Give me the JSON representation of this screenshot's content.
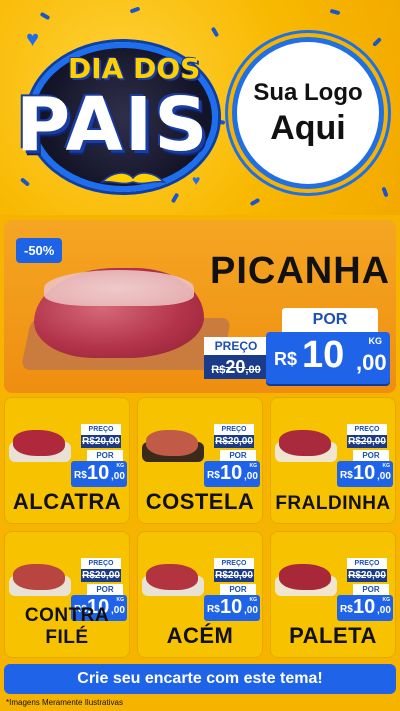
{
  "header": {
    "title_top": "DIA DOS",
    "title_main": "PAIS",
    "logo_line1": "Sua Logo",
    "logo_line2": "Aqui"
  },
  "featured": {
    "discount": "-50%",
    "name": "PICANHA",
    "preco_label": "PREÇO",
    "old_currency": "R$",
    "old_int": "20",
    "old_dec": ",00",
    "por_label": "POR",
    "new_currency": "R$",
    "new_int": "10",
    "new_dec": ",00",
    "unit": "KG"
  },
  "products": [
    {
      "name": "ALCATRA",
      "preco_label": "PREÇO",
      "old": "R$20,00",
      "por_label": "POR",
      "cur": "R$",
      "int": "10",
      "dec": ",00",
      "unit": "KG"
    },
    {
      "name": "COSTELA",
      "preco_label": "PREÇO",
      "old": "R$20,00",
      "por_label": "POR",
      "cur": "R$",
      "int": "10",
      "dec": ",00",
      "unit": "KG"
    },
    {
      "name": "FRALDINHA",
      "preco_label": "PREÇO",
      "old": "R$20,00",
      "por_label": "POR",
      "cur": "R$",
      "int": "10",
      "dec": ",00",
      "unit": "KG"
    },
    {
      "name": "CONTRA FILÉ",
      "preco_label": "PREÇO",
      "old": "R$20,00",
      "por_label": "POR",
      "cur": "R$",
      "int": "10",
      "dec": ",00",
      "unit": "KG"
    },
    {
      "name": "ACÉM",
      "preco_label": "PREÇO",
      "old": "R$20,00",
      "por_label": "POR",
      "cur": "R$",
      "int": "10",
      "dec": ",00",
      "unit": "KG"
    },
    {
      "name": "PALETA",
      "preco_label": "PREÇO",
      "old": "R$20,00",
      "por_label": "POR",
      "cur": "R$",
      "int": "10",
      "dec": ",00",
      "unit": "KG"
    }
  ],
  "cta": "Crie seu encarte com este tema!",
  "disclaimer": "*Imagens Meramente Ilustrativas",
  "colors": {
    "background": "#f6b400",
    "accent_blue": "#1f63e8",
    "dark_blue": "#1a3a8a",
    "featured_orange": "#ef8e10"
  }
}
